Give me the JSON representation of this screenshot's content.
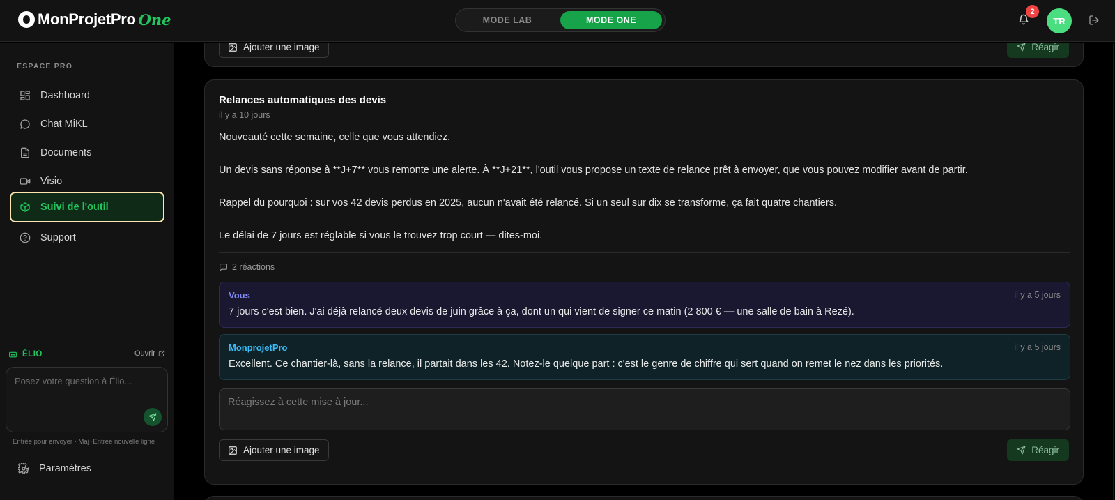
{
  "brand": {
    "name": "MonProjetPro",
    "suffix": "One"
  },
  "mode_switch": {
    "lab_label": "MODE LAB",
    "one_label": "MODE ONE",
    "active": "one"
  },
  "header": {
    "notification_count": "2",
    "avatar_initials": "TR"
  },
  "sidebar": {
    "section_label": "ESPACE PRO",
    "items": [
      {
        "label": "Dashboard",
        "icon": "dashboard-icon"
      },
      {
        "label": "Chat MiKL",
        "icon": "chat-icon"
      },
      {
        "label": "Documents",
        "icon": "document-icon"
      },
      {
        "label": "Visio",
        "icon": "video-icon"
      },
      {
        "label": "Suivi de l'outil",
        "icon": "box-icon",
        "active": true
      },
      {
        "label": "Support",
        "icon": "help-icon"
      }
    ],
    "settings_label": "Paramètres"
  },
  "elio": {
    "title": "ÉLIO",
    "open_label": "Ouvrir",
    "placeholder": "Posez votre question à Élio...",
    "hint": "Entrée pour envoyer · Maj+Entrée nouvelle ligne"
  },
  "prev_card": {
    "add_image_label": "Ajouter une image",
    "react_label": "Réagir"
  },
  "post": {
    "title": "Relances automatiques des devis",
    "date": "il y a 10 jours",
    "paragraphs": [
      "Nouveauté cette semaine, celle que vous attendiez.",
      "Un devis sans réponse à **J+7** vous remonte une alerte. À **J+21**, l'outil vous propose un texte de relance prêt à envoyer, que vous pouvez modifier avant de partir.",
      "Rappel du pourquoi : sur vos 42 devis perdus en 2025, aucun n'avait été relancé. Si un seul sur dix se transforme, ça fait quatre chantiers.",
      "Le délai de 7 jours est réglable si vous le trouvez trop court — dites-moi."
    ],
    "reactions_label": "2 réactions",
    "comments": [
      {
        "author": "Vous",
        "date": "il y a 5 jours",
        "text": "7 jours c'est bien. J'ai déjà relancé deux devis de juin grâce à ça, dont un qui vient de signer ce matin (2 800 € — une salle de bain à Rezé)."
      },
      {
        "author": "MonprojetPro",
        "date": "il y a 5 jours",
        "text": "Excellent. Ce chantier-là, sans la relance, il partait dans les 42. Notez-le quelque part : c'est le genre de chiffre qui sert quand on remet le nez dans les priorités."
      }
    ],
    "react_placeholder": "Réagissez à cette mise à jour...",
    "add_image_label": "Ajouter une image",
    "react_label": "Réagir"
  },
  "colors": {
    "accent": "#22c55e",
    "accent_dark": "#16a34a",
    "badge": "#ef4444",
    "you_author": "#818cf8",
    "mp_author": "#38bdf8",
    "active_border": "#fde6b4"
  }
}
